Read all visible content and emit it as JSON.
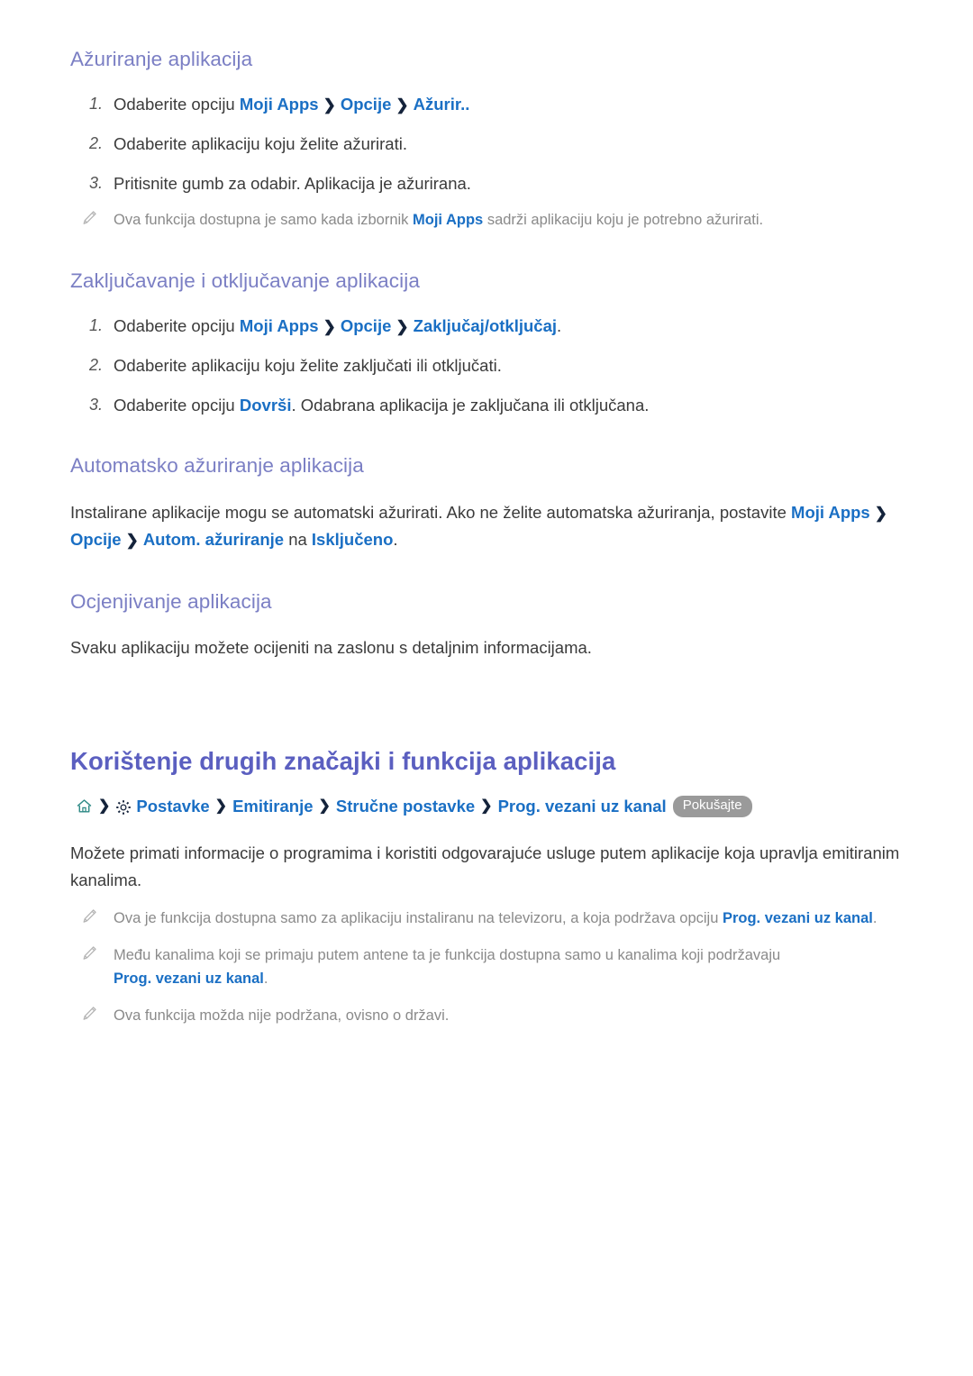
{
  "sections": {
    "update_apps": {
      "heading": "Ažuriranje aplikacija",
      "steps": [
        {
          "num": "1.",
          "prefix": "Odaberite opciju ",
          "links": [
            "Moji Apps",
            "Opcije",
            "Ažurir.."
          ],
          "suffix": ""
        },
        {
          "num": "2.",
          "text": "Odaberite aplikaciju koju želite ažurirati."
        },
        {
          "num": "3.",
          "text": "Pritisnite gumb za odabir. Aplikacija je ažurirana."
        }
      ],
      "note": {
        "icon": "pencil-icon",
        "before": "Ova funkcija dostupna je samo kada izbornik ",
        "link": "Moji Apps",
        "after": " sadrži aplikaciju koju je potrebno ažurirati."
      }
    },
    "lock_unlock_apps": {
      "heading": "Zaključavanje i otključavanje aplikacija",
      "steps": [
        {
          "num": "1.",
          "prefix": "Odaberite opciju ",
          "links": [
            "Moji Apps",
            "Opcije",
            "Zaključaj/otključaj"
          ],
          "suffix": "."
        },
        {
          "num": "2.",
          "text": "Odaberite aplikaciju koju želite zaključati ili otključati."
        },
        {
          "num": "3.",
          "prefix": "Odaberite opciju ",
          "link": "Dovrši",
          "suffix": ". Odabrana aplikacija je zaključana ili otključana."
        }
      ]
    },
    "auto_update_apps": {
      "heading": "Automatsko ažuriranje aplikacija",
      "paragraph": {
        "before": "Instalirane aplikacije mogu se automatski ažurirati. Ako ne želite automatska ažuriranja, postavite ",
        "path": [
          "Moji Apps",
          "Opcije",
          "Autom. ažuriranje"
        ],
        "middle": " na ",
        "value": "Isključeno",
        "after": "."
      }
    },
    "rate_apps": {
      "heading": "Ocjenjivanje aplikacija",
      "paragraph": "Svaku aplikaciju možete ocijeniti na zaslonu s detaljnim informacijama."
    },
    "other_features": {
      "heading": "Korištenje drugih značajki i funkcija aplikacija",
      "breadcrumb": {
        "home_icon": "home-icon",
        "gear_icon": "gear-icon",
        "crumbs": [
          "Postavke",
          "Emitiranje",
          "Stručne postavke",
          "Prog. vezani uz kanal"
        ],
        "try_label": "Pokušajte"
      },
      "paragraph": "Možete primati informacije o programima i koristiti odgovarajuće usluge putem aplikacije koja upravlja emitiranim kanalima.",
      "notes": [
        {
          "icon": "pencil-icon",
          "before": "Ova je funkcija dostupna samo za aplikaciju instaliranu na televizoru, a koja podržava opciju ",
          "link": "Prog. vezani uz kanal",
          "after": "."
        },
        {
          "icon": "pencil-icon",
          "before": "Među kanalima koji se primaju putem antene ta je funkcija dostupna samo u kanalima koji podržavaju ",
          "link": "Prog. vezani uz kanal",
          "after": "."
        },
        {
          "icon": "pencil-icon",
          "before": "Ova funkcija možda nije podržana, ovisno o državi.",
          "link": "",
          "after": ""
        }
      ]
    }
  },
  "colors": {
    "section_heading": "#7b7fc4",
    "main_heading": "#5b5fc0",
    "link": "#1a6fc4",
    "body_text": "#3b3b3b",
    "note_text": "#8a8a8a",
    "pill_background": "#9a9a9a",
    "chevron": "#14233b",
    "home_icon": "#2e8a86"
  }
}
